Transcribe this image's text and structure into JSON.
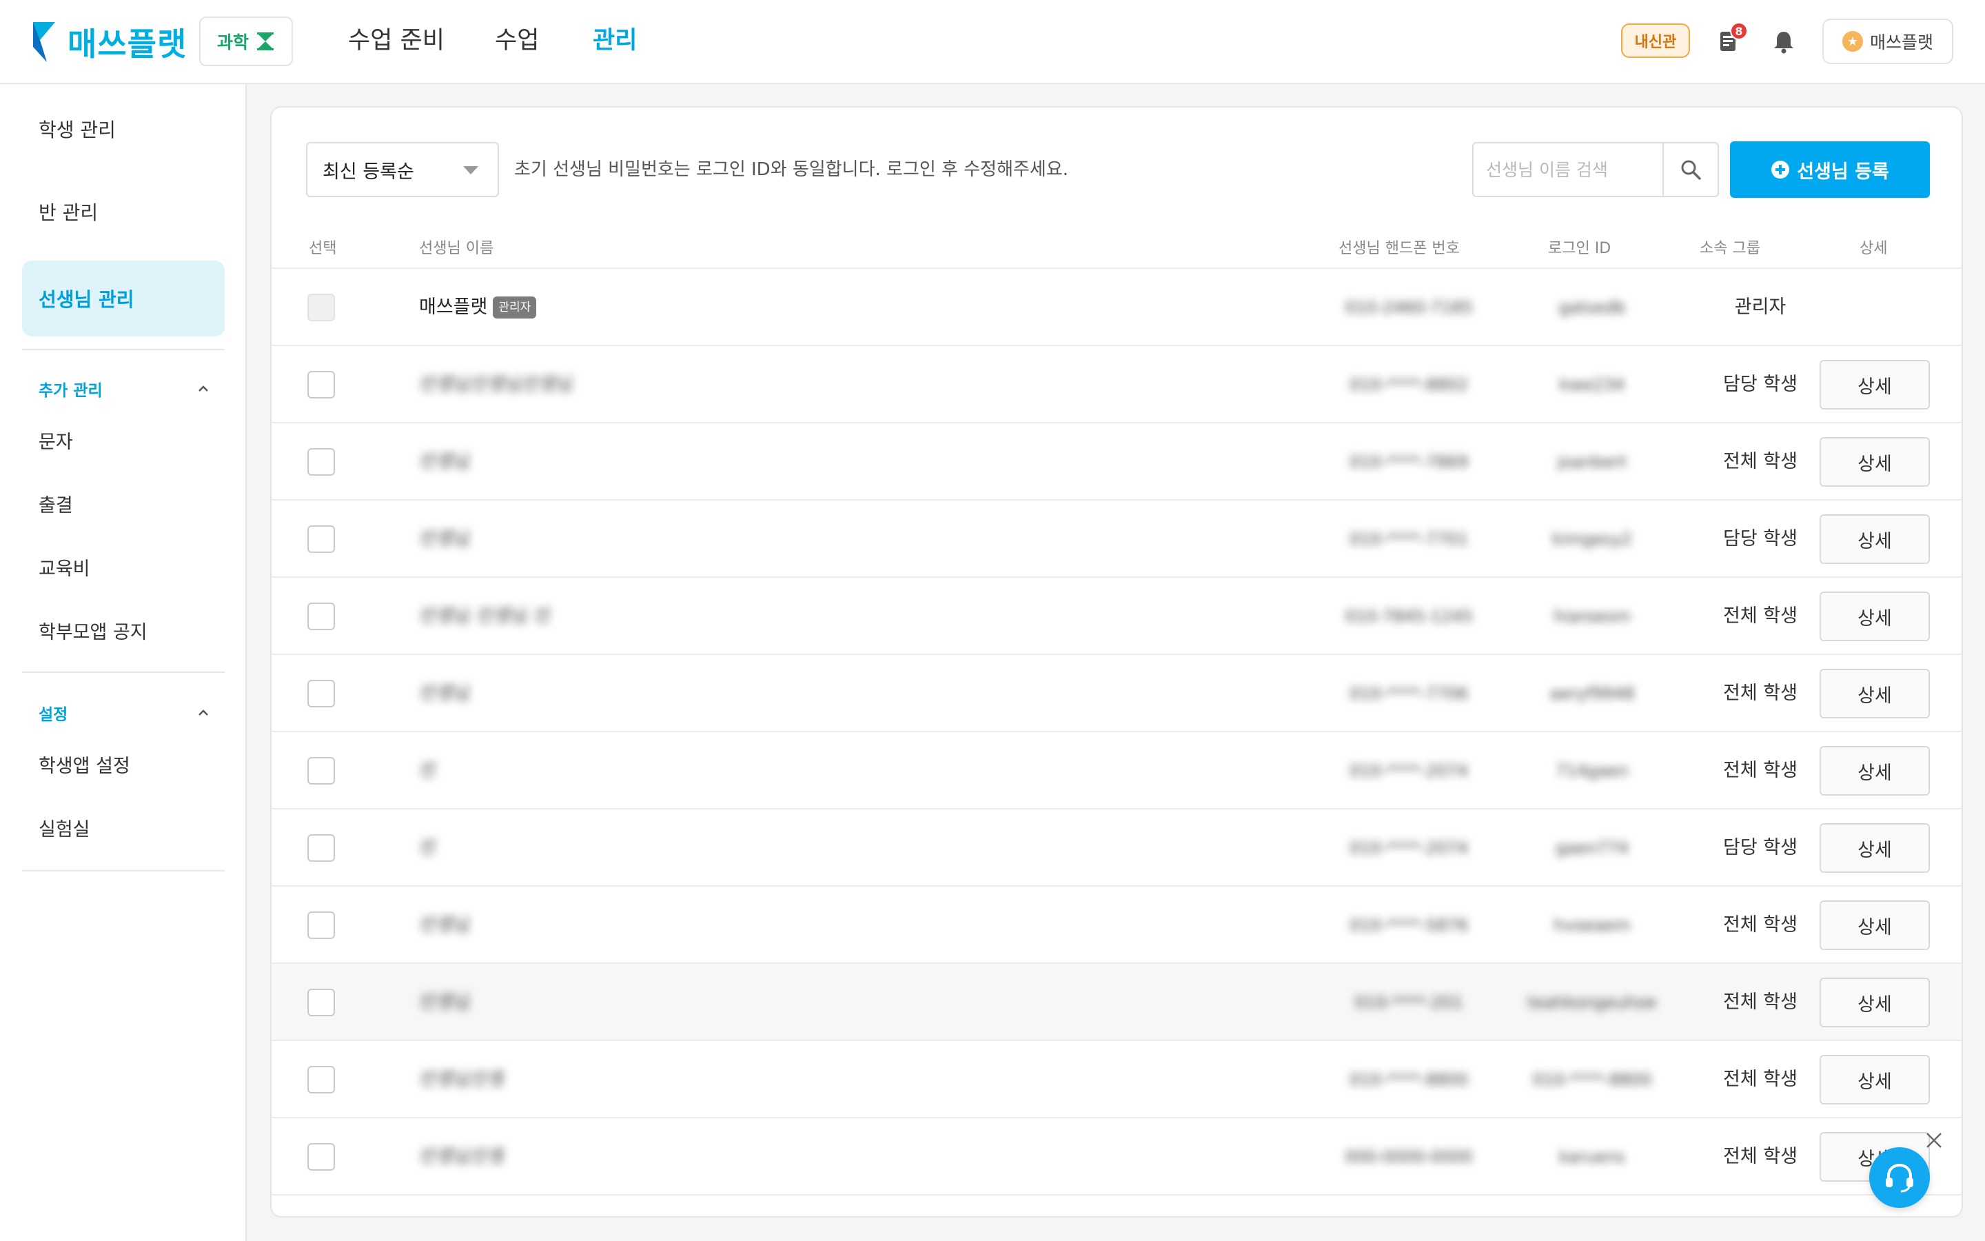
{
  "header": {
    "logo_text": "매쓰플랫",
    "subject": "과학",
    "nav": [
      {
        "label": "수업 준비",
        "active": false
      },
      {
        "label": "수업",
        "active": false
      },
      {
        "label": "관리",
        "active": true
      }
    ],
    "naesin_label": "내신관",
    "notice_count": "8",
    "user_name": "매쓰플랫"
  },
  "sidebar": {
    "main_items": [
      {
        "label": "학생 관리",
        "active": false
      },
      {
        "label": "반 관리",
        "active": false
      },
      {
        "label": "선생님 관리",
        "active": true
      }
    ],
    "sections": [
      {
        "title": "추가 관리",
        "items": [
          "문자",
          "출결",
          "교육비",
          "학부모앱 공지"
        ]
      },
      {
        "title": "설정",
        "items": [
          "학생앱 설정",
          "실험실"
        ]
      }
    ]
  },
  "toolbar": {
    "sort_value": "최신 등록순",
    "notice": "초기 선생님 비밀번호는 로그인 ID와 동일합니다. 로그인 후 수정해주세요.",
    "search_placeholder": "선생님 이름 검색",
    "register_label": "선생님 등록"
  },
  "table": {
    "headers": {
      "select": "선택",
      "name": "선생님 이름",
      "phone": "선생님 핸드폰 번호",
      "login": "로그인 ID",
      "group": "소속 그룹",
      "detail": "상세"
    },
    "admin_tag": "관리자",
    "detail_label": "상세",
    "rows": [
      {
        "name": "매쓰플랫",
        "is_admin": true,
        "phone": "010-2460-7185",
        "login_id": "gatsedb",
        "group": "관리자"
      },
      {
        "name": "선생님선생님선생님",
        "is_admin": false,
        "phone": "010-****-8802",
        "login_id": "kwe234",
        "group": "담당 학생"
      },
      {
        "name": "선생님",
        "is_admin": false,
        "phone": "010-****-7869",
        "login_id": "joanbert",
        "group": "전체 학생"
      },
      {
        "name": "선생님",
        "is_admin": false,
        "phone": "010-****-7701",
        "login_id": "kimgesy2",
        "group": "담당 학생"
      },
      {
        "name": "선생님 선생님 선",
        "is_admin": false,
        "phone": "010-7845-1245",
        "login_id": "hiaroesm",
        "group": "전체 학생"
      },
      {
        "name": "선생님",
        "is_admin": false,
        "phone": "010-****-7706",
        "login_id": "aeryf9948",
        "group": "전체 학생"
      },
      {
        "name": "선",
        "is_admin": false,
        "phone": "010-****-2074",
        "login_id": "714gaen",
        "group": "전체 학생"
      },
      {
        "name": "선",
        "is_admin": false,
        "phone": "010-****-2074",
        "login_id": "gaen774",
        "group": "담당 학생"
      },
      {
        "name": "선생님",
        "is_admin": false,
        "phone": "010-****-5876",
        "login_id": "hvoeaem",
        "group": "전체 학생"
      },
      {
        "name": "선생님",
        "is_admin": false,
        "phone": "010-****-201",
        "login_id": "teahkongeuhoe",
        "group": "전체 학생"
      },
      {
        "name": "선생님선생",
        "is_admin": false,
        "phone": "010-****-8800",
        "login_id": "010-****-8800",
        "group": "전체 학생"
      },
      {
        "name": "선생님선생",
        "is_admin": false,
        "phone": "000-0000-0000",
        "login_id": "karuens",
        "group": "전체 학생"
      }
    ]
  }
}
